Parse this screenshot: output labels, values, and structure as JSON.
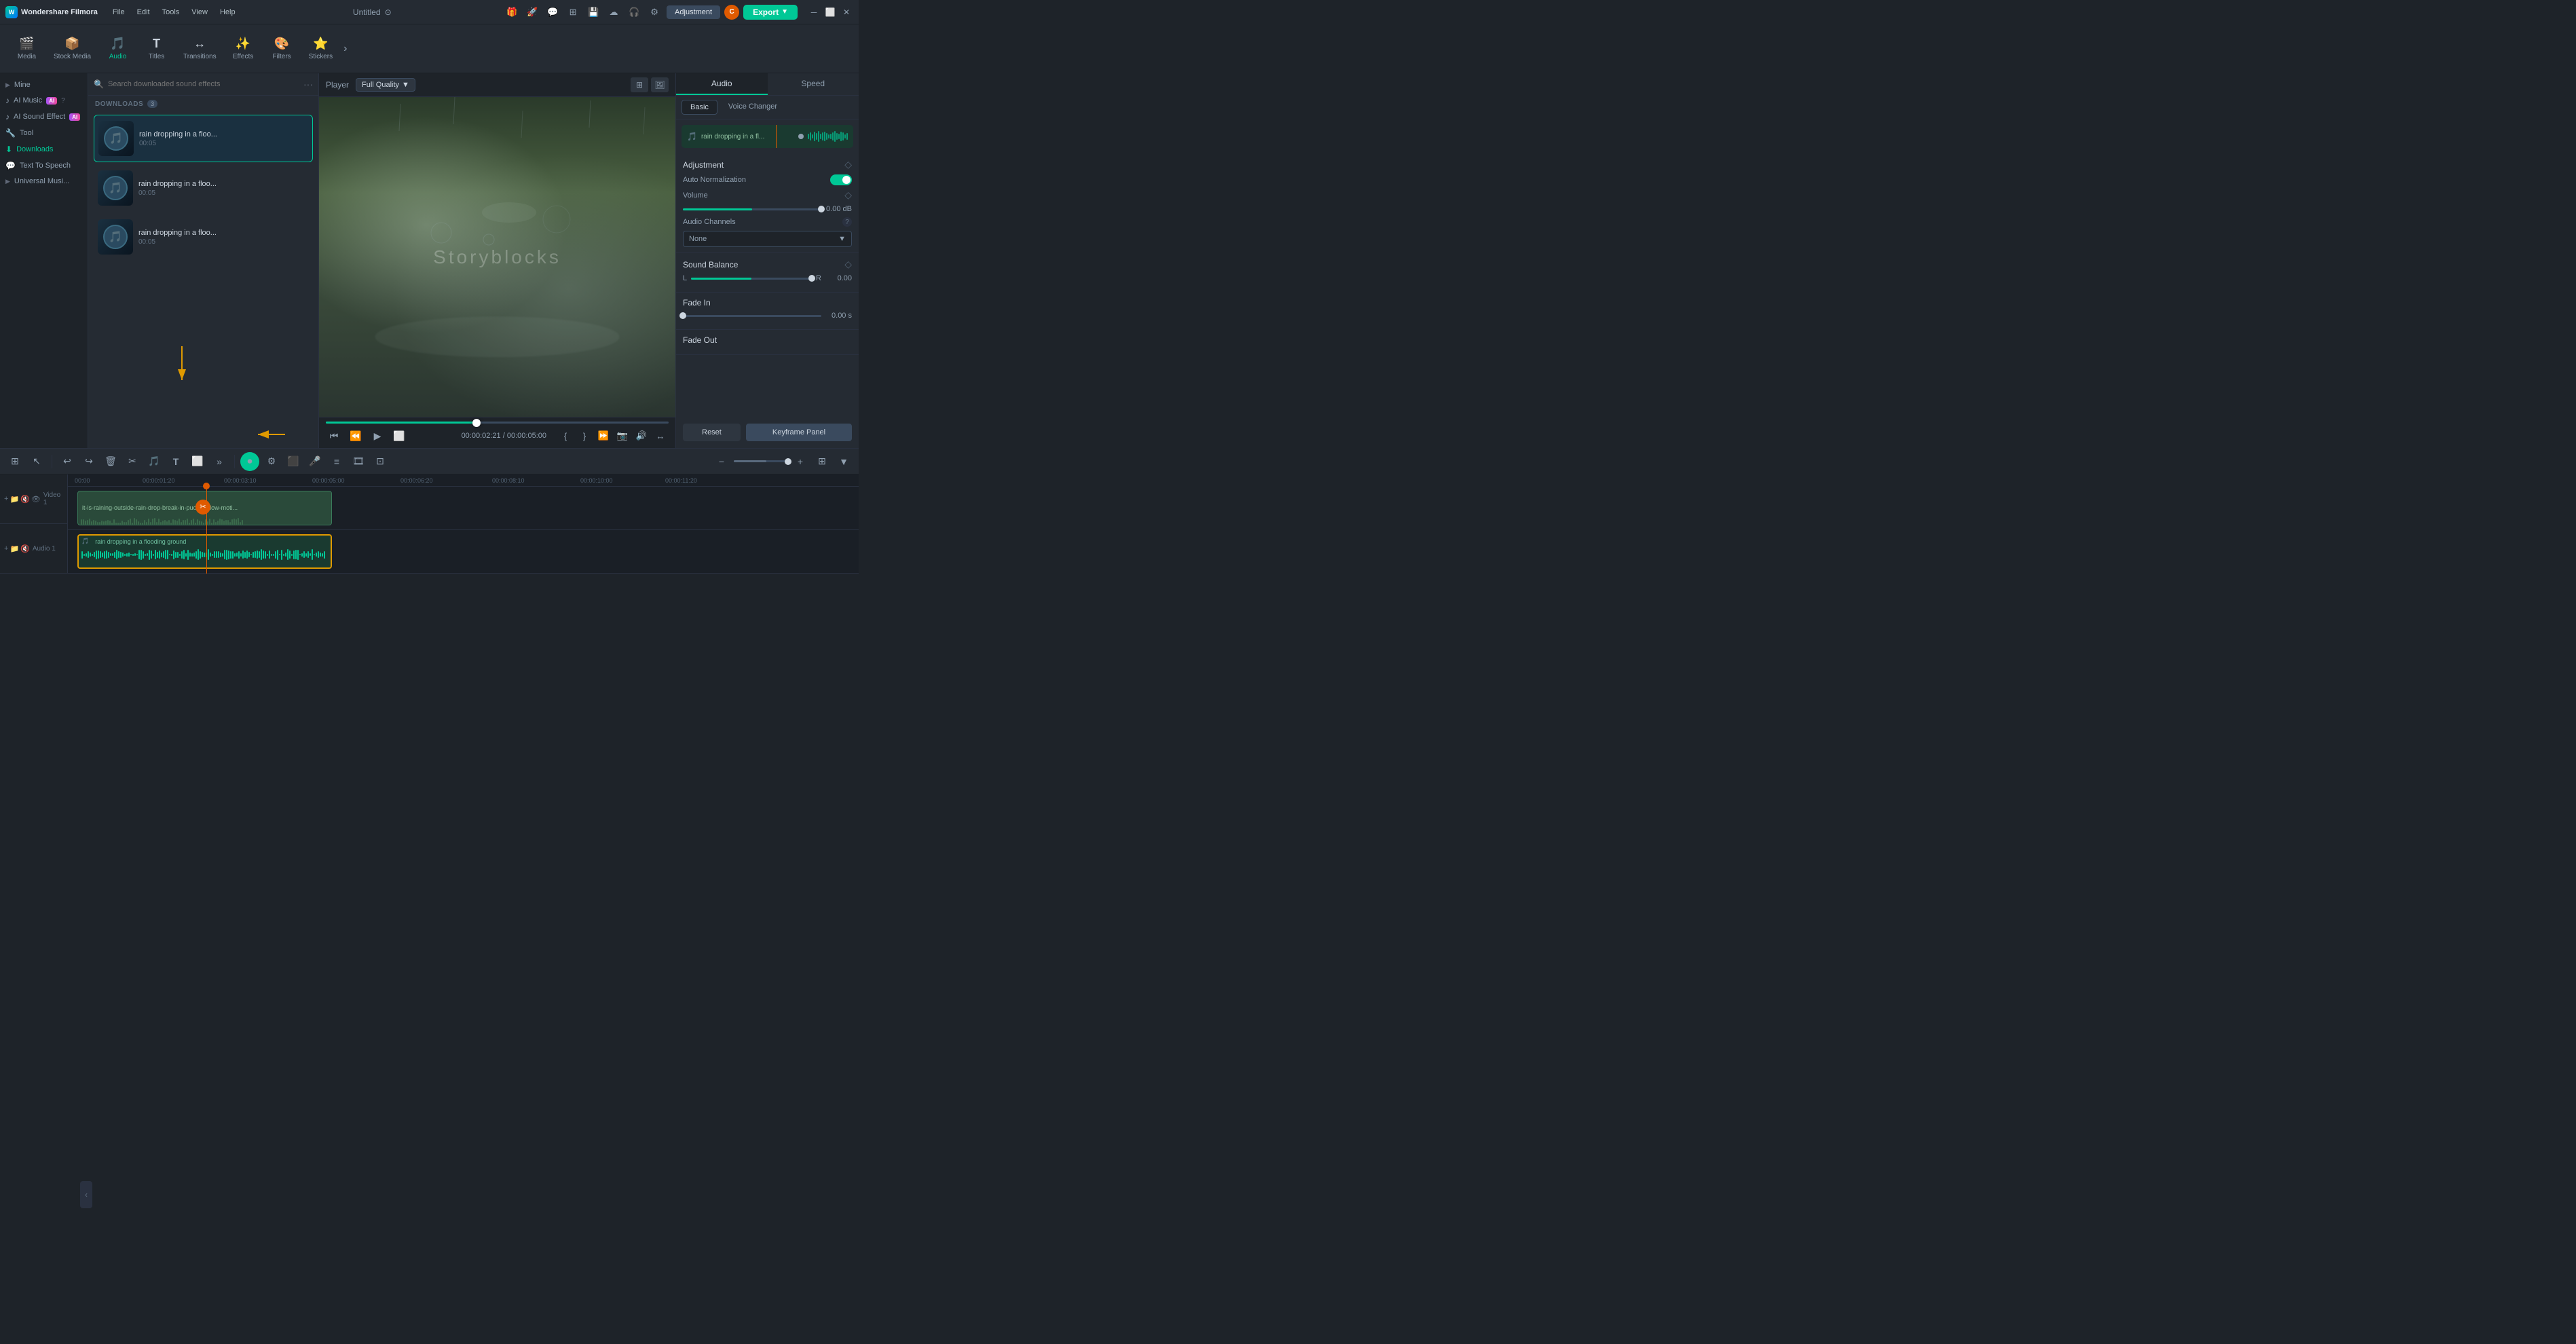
{
  "app": {
    "title": "Wondershare Filmora",
    "project_name": "Untitled",
    "logo_letter": "W"
  },
  "menu": {
    "items": [
      "File",
      "Edit",
      "Tools",
      "View",
      "Help"
    ]
  },
  "toolbar": {
    "items": [
      {
        "id": "media",
        "icon": "🎬",
        "label": "Media",
        "active": false
      },
      {
        "id": "stock-media",
        "icon": "📦",
        "label": "Stock Media",
        "active": false
      },
      {
        "id": "audio",
        "icon": "🎵",
        "label": "Audio",
        "active": true
      },
      {
        "id": "titles",
        "icon": "T",
        "label": "Titles",
        "active": false
      },
      {
        "id": "transitions",
        "icon": "↔",
        "label": "Transitions",
        "active": false
      },
      {
        "id": "effects",
        "icon": "✨",
        "label": "Effects",
        "active": false
      },
      {
        "id": "filters",
        "icon": "🎨",
        "label": "Filters",
        "active": false
      },
      {
        "id": "stickers",
        "icon": "⭐",
        "label": "Stickers",
        "active": false
      }
    ],
    "more": "›"
  },
  "sidebar": {
    "items": [
      {
        "id": "mine",
        "label": "Mine",
        "icon": "▶",
        "has_arrow": true
      },
      {
        "id": "ai-music",
        "label": "AI Music",
        "icon": "♪",
        "has_badge": true,
        "badge": "AI"
      },
      {
        "id": "ai-sound-effect",
        "label": "AI Sound Effect",
        "icon": "♪",
        "has_badge": true,
        "badge": "AI"
      },
      {
        "id": "tool",
        "label": "Tool",
        "icon": "🔧"
      },
      {
        "id": "downloads",
        "label": "Downloads",
        "icon": "⬇",
        "active": true
      },
      {
        "id": "text-to-speech",
        "label": "Text To Speech",
        "icon": "💬"
      },
      {
        "id": "universal-music",
        "label": "Universal Musi...",
        "icon": "▶",
        "has_arrow": true
      }
    ]
  },
  "content_panel": {
    "search_placeholder": "Search downloaded sound effects",
    "downloads_label": "DOWNLOADS",
    "downloads_count": "3",
    "sound_items": [
      {
        "id": 1,
        "name": "rain dropping in a floo...",
        "duration": "00:05",
        "selected": true
      },
      {
        "id": 2,
        "name": "rain dropping in a floo...",
        "duration": "00:05",
        "selected": false
      },
      {
        "id": 3,
        "name": "rain dropping in a floo...",
        "duration": "00:05",
        "selected": false
      }
    ]
  },
  "player": {
    "label": "Player",
    "quality": "Full Quality",
    "watermark": "Storyblocks",
    "current_time": "00:00:02:21",
    "total_time": "00:00:05:00",
    "progress_percent": 44
  },
  "right_panel": {
    "tabs": [
      "Audio",
      "Speed"
    ],
    "active_tab": "Audio",
    "sub_tabs": [
      "Basic",
      "Voice Changer"
    ],
    "active_sub_tab": "Basic",
    "clip_name": "rain dropping in a fl...",
    "adjustment_title": "Adjustment",
    "auto_normalization": {
      "label": "Auto Normalization",
      "enabled": true
    },
    "volume": {
      "label": "Volume",
      "value": "0.00",
      "unit": "dB"
    },
    "audio_channels": {
      "label": "Audio Channels",
      "info": "?",
      "value": "None"
    },
    "sound_balance": {
      "label": "Sound Balance",
      "left": "L",
      "right": "R",
      "value": "0.00"
    },
    "fade_in": {
      "label": "Fade In",
      "value": "0.00",
      "unit": "s"
    },
    "fade_out": {
      "label": "Fade Out"
    },
    "reset_label": "Reset",
    "keyframe_label": "Keyframe Panel"
  },
  "timeline": {
    "toolbar_icons": [
      "grid",
      "cursor",
      "undo",
      "redo",
      "delete",
      "cut",
      "music-note",
      "text",
      "frame",
      "more"
    ],
    "undo_label": "↩",
    "redo_label": "↪",
    "delete_label": "🗑",
    "cut_label": "✂",
    "play_label": "▶",
    "ruler_marks": [
      "00:00",
      "00:00:01:20",
      "00:00:03:10",
      "00:00:05:00",
      "00:00:06:20",
      "00:00:08:10",
      "00:00:10:00",
      "00:00:11:20"
    ],
    "video_track_label": "Video 1",
    "audio_track_label": "Audio 1",
    "video_clip_text": "it-is-raining-outside-rain-drop-break-in-puddle-slow-moti...",
    "audio_clip_text": "rain dropping in a flooding ground",
    "current_playhead": "00:00:02:21",
    "zoom_controls": [
      "-",
      "+"
    ]
  },
  "colors": {
    "accent": "#00c896",
    "orange": "#e05a00",
    "bg_dark": "#1e2329",
    "bg_mid": "#252b33",
    "border": "#2a3140"
  }
}
